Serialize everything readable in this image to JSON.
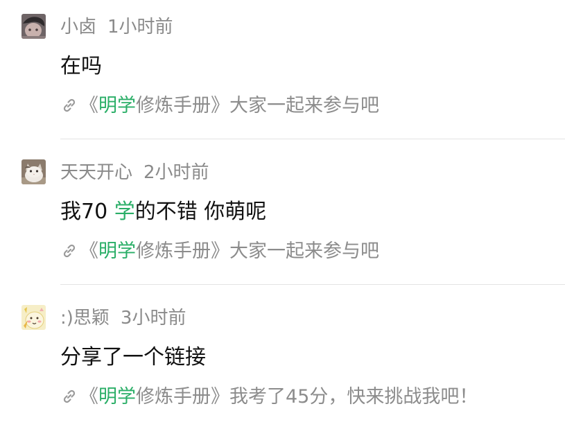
{
  "feed": {
    "posts": [
      {
        "username": "小卤",
        "time": "1小时前",
        "message": "在吗",
        "share": {
          "prefix": "《",
          "highlight": "明学",
          "rest": "修炼手册》大家一起来参与吧"
        },
        "avatar_icon": "avatar-dark-photo-icon"
      },
      {
        "username": "天天开心",
        "time": "2小时前",
        "message": {
          "before": "我70 ",
          "highlight": "学",
          "after": "的不错 你萌呢"
        },
        "share": {
          "prefix": "《",
          "highlight": "明学",
          "rest": "修炼手册》大家一起来参与吧"
        },
        "avatar_icon": "avatar-cat-photo-icon"
      },
      {
        "username": ":)思颖",
        "time": "3小时前",
        "message": "分享了一个链接",
        "share": {
          "prefix": "《",
          "highlight": "明学",
          "rest": "修炼手册》我考了45分，快来挑战我吧！"
        },
        "avatar_icon": "avatar-cartoon-icon"
      }
    ],
    "link_icon": "link-icon"
  },
  "colors": {
    "highlight": "#2aae67",
    "meta_text": "#8a8a8a",
    "message_text": "#111111",
    "divider": "#e3e3e3"
  }
}
